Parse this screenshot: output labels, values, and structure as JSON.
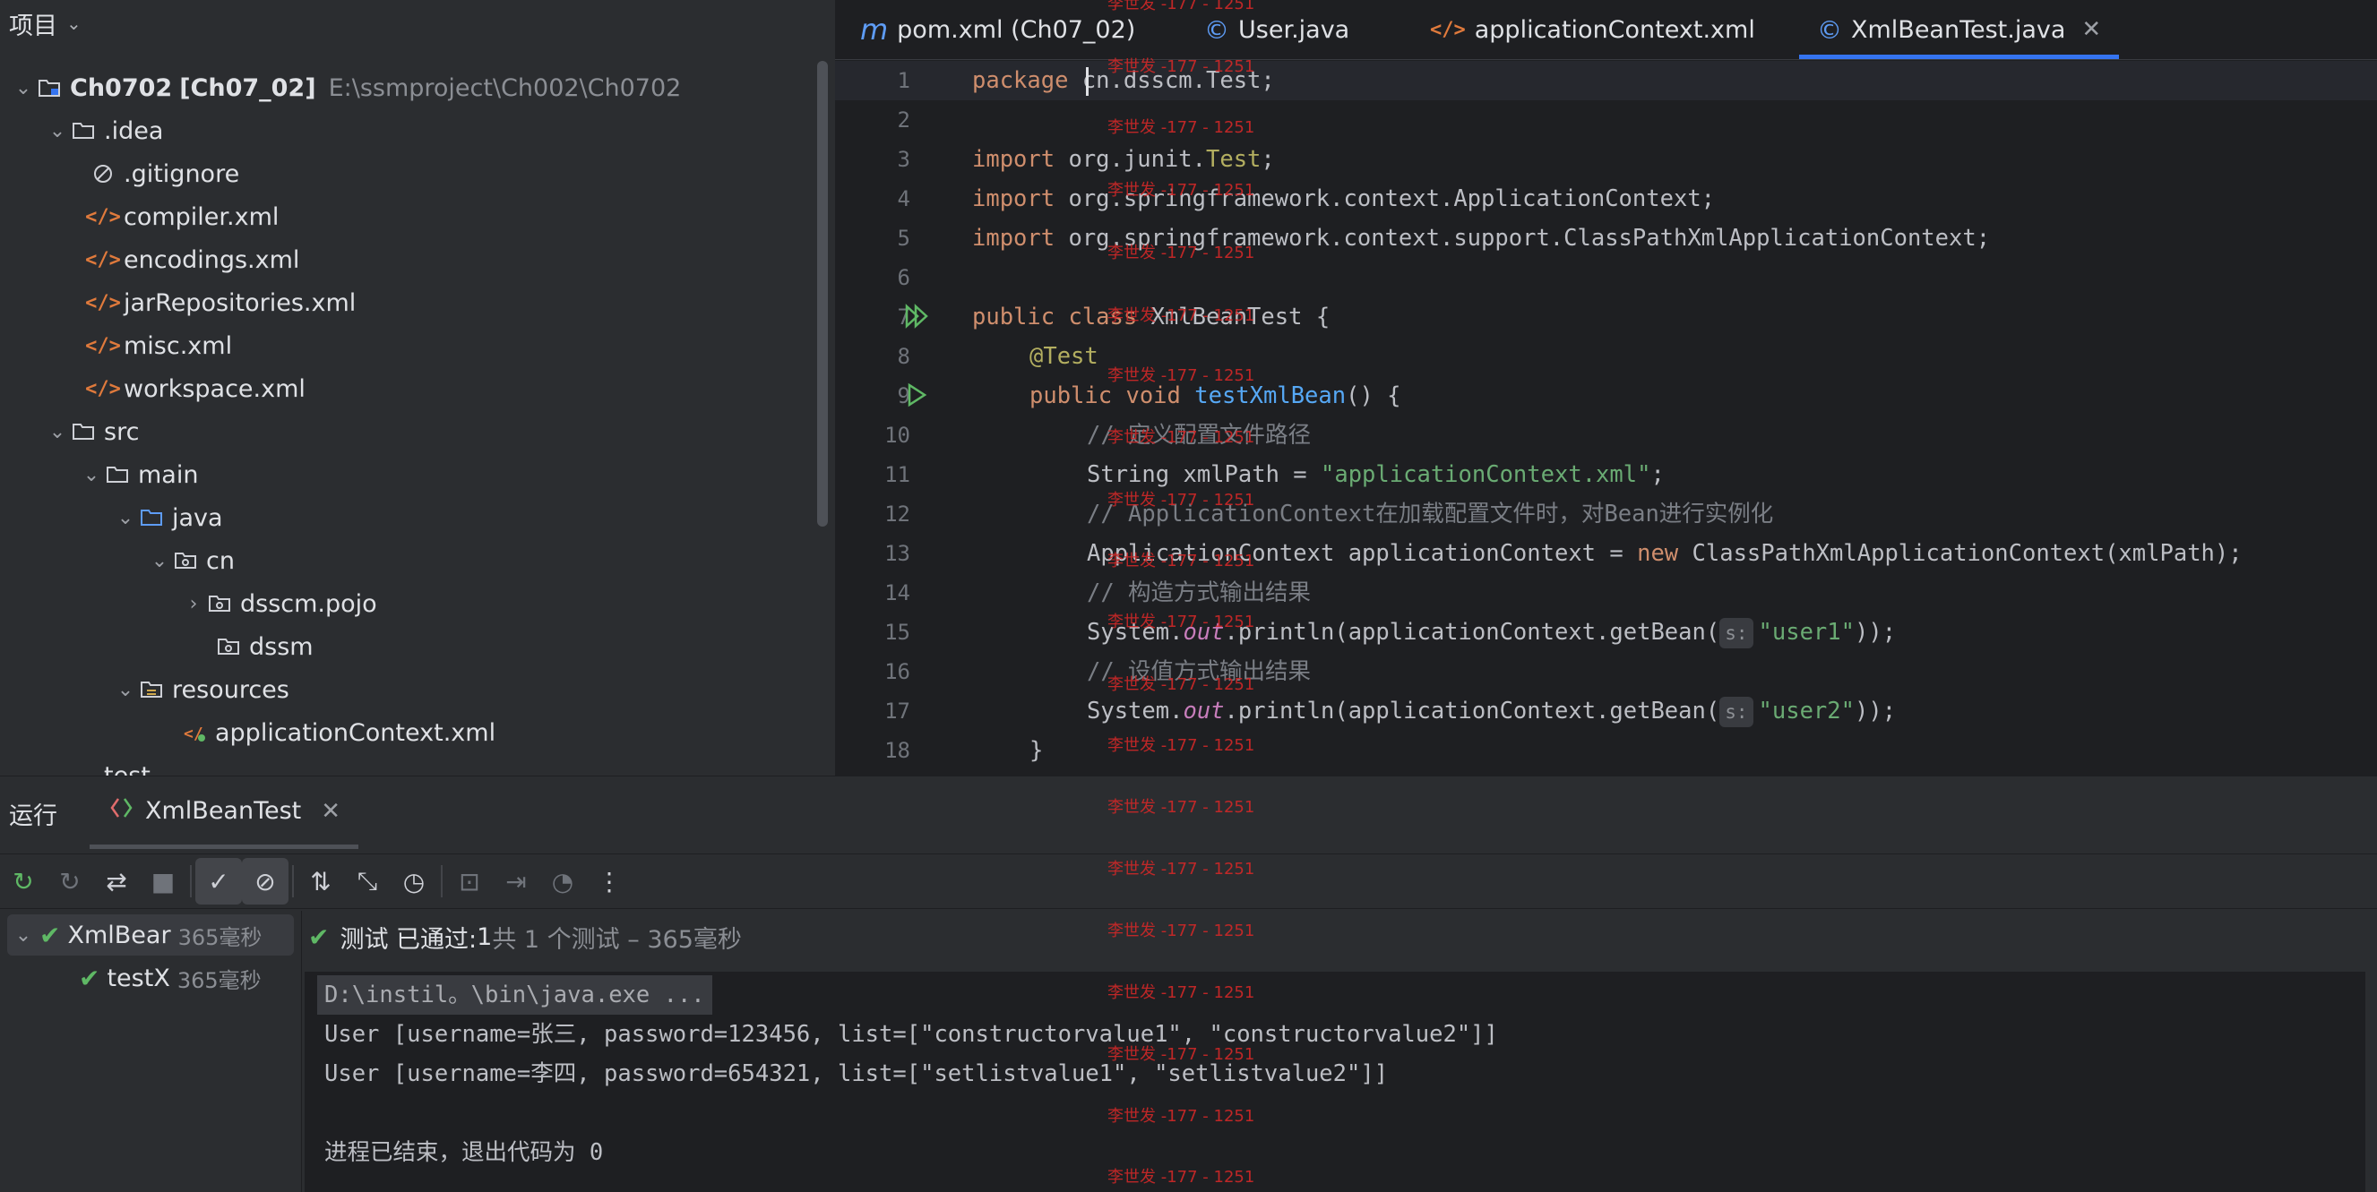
{
  "project_panel": {
    "title": "项目",
    "root_name": "Ch0702",
    "root_module": "[Ch07_02]",
    "root_path": "E:\\ssmproject\\Ch002\\Ch0702",
    "items": [
      {
        "label": ".idea"
      },
      {
        "label": ".gitignore"
      },
      {
        "label": "compiler.xml"
      },
      {
        "label": "encodings.xml"
      },
      {
        "label": "jarRepositories.xml"
      },
      {
        "label": "misc.xml"
      },
      {
        "label": "workspace.xml"
      },
      {
        "label": "src"
      },
      {
        "label": "main"
      },
      {
        "label": "java"
      },
      {
        "label": "cn"
      },
      {
        "label": "dsscm.pojo"
      },
      {
        "label": "dssm"
      },
      {
        "label": "resources"
      },
      {
        "label": "applicationContext.xml"
      },
      {
        "label": "test"
      }
    ]
  },
  "editor": {
    "tabs": [
      {
        "label": "pom.xml (Ch07_02)",
        "icon": "m"
      },
      {
        "label": "User.java",
        "icon": "©"
      },
      {
        "label": "applicationContext.xml",
        "icon": "</>"
      },
      {
        "label": "XmlBeanTest.java",
        "icon": "©"
      }
    ],
    "line_numbers": [
      "1",
      "2",
      "3",
      "4",
      "5",
      "6",
      "7",
      "8",
      "9",
      "10",
      "11",
      "12",
      "13",
      "14",
      "15",
      "16",
      "17",
      "18"
    ],
    "code": {
      "l1_kw": "package ",
      "l1_rest": "cn.dsscm.Test;",
      "l3_kw": "import ",
      "l3_a": "org.junit.",
      "l3_b": "Test",
      "l3_c": ";",
      "l4_kw": "import ",
      "l4_rest": "org.springframework.context.ApplicationContext;",
      "l5_kw": "import ",
      "l5_rest": "org.springframework.context.support.ClassPathXmlApplicationContext;",
      "l7_kw": "public class ",
      "l7_rest": "XmlBeanTest {",
      "l8": "@Test",
      "l9_kw": "public void ",
      "l9_fn": "testXmlBean",
      "l9_rest": "() {",
      "l10": "// 定义配置文件路径",
      "l11_a": "String xmlPath = ",
      "l11_str": "\"applicationContext.xml\"",
      "l11_c": ";",
      "l12": "// ApplicationContext在加载配置文件时，对Bean进行实例化",
      "l13_a": "ApplicationContext applicationContext = ",
      "l13_kw": "new ",
      "l13_rest": "ClassPathXmlApplicationContext(xmlPath);",
      "l14": "// 构造方式输出结果",
      "l15_a": "System.",
      "l15_st": "out",
      "l15_b": ".println(applicationContext.getBean(",
      "l15_hint": "s:",
      "l15_str": "\"user1\"",
      "l15_c": "));",
      "l16": "// 设值方式输出结果",
      "l17_a": "System.",
      "l17_st": "out",
      "l17_b": ".println(applicationContext.getBean(",
      "l17_hint": "s:",
      "l17_str": "\"user2\"",
      "l17_c": "));",
      "l18": "}"
    }
  },
  "run_panel": {
    "title": "运行",
    "tab_label": "XmlBeanTest",
    "tests": [
      {
        "label": "XmlBear",
        "duration": "365毫秒"
      },
      {
        "label": "testX",
        "duration": "365毫秒"
      }
    ],
    "status_prefix": "测试 已通过: ",
    "status_count": "1",
    "status_suffix": "共 1 个测试 – 365毫秒",
    "console": [
      "D:\\instil。\\bin\\java.exe ...",
      "User [username=张三, password=123456, list=[\"constructorvalue1\", \"constructorvalue2\"]]",
      "User [username=李四, password=654321, list=[\"setlistvalue1\", \"setlistvalue2\"]]",
      "",
      "进程已结束，退出代码为 0"
    ]
  },
  "watermark": "李世发 -177 - 1251",
  "colors": {
    "accent": "#3574f0",
    "success": "#5fb865",
    "keyword": "#cf8e6d",
    "string": "#6aab73",
    "watermark": "#d02828"
  }
}
